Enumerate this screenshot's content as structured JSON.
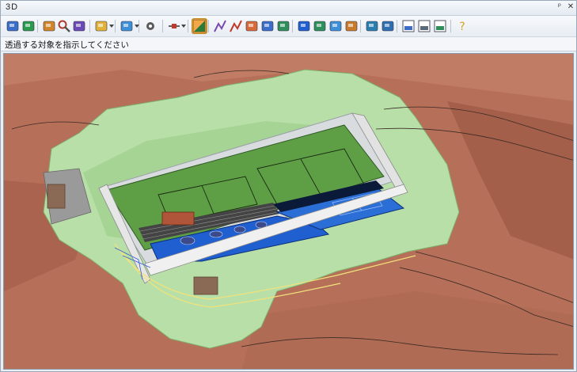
{
  "window": {
    "title": "3D",
    "pin_icon": "pin-icon",
    "close_icon": "close-icon"
  },
  "toolbar": {
    "tools": [
      {
        "name": "rotate-view-icon",
        "glyph": "rotate"
      },
      {
        "name": "globe-view-icon",
        "glyph": "globe"
      },
      {
        "name": "fit-view-icon",
        "glyph": "fit"
      },
      {
        "name": "zoom-icon",
        "glyph": "zoom"
      },
      {
        "name": "camera-view-icon",
        "glyph": "camera"
      },
      {
        "name": "light-icon",
        "glyph": "light"
      },
      {
        "name": "cube-view-icon",
        "glyph": "cube"
      },
      {
        "name": "settings-icon",
        "glyph": "settings"
      },
      {
        "name": "measure-icon",
        "glyph": "measure"
      },
      {
        "name": "surface-color-icon",
        "glyph": "surface"
      },
      {
        "name": "draw-line-icon",
        "glyph": "line"
      },
      {
        "name": "polyline-icon",
        "glyph": "polyline"
      },
      {
        "name": "terrain-icon",
        "glyph": "terrain"
      },
      {
        "name": "section-icon",
        "glyph": "section"
      },
      {
        "name": "slope-icon",
        "glyph": "slope"
      },
      {
        "name": "layer-icon",
        "glyph": "layer"
      },
      {
        "name": "tree-icon",
        "glyph": "tree"
      },
      {
        "name": "paint-icon",
        "glyph": "paint"
      },
      {
        "name": "book-icon",
        "glyph": "book"
      },
      {
        "name": "walk-icon",
        "glyph": "walk"
      },
      {
        "name": "person-icon",
        "glyph": "person"
      },
      {
        "name": "export-image-icon",
        "glyph": "export"
      },
      {
        "name": "print-icon",
        "glyph": "print"
      },
      {
        "name": "picture-icon",
        "glyph": "picture"
      },
      {
        "name": "help-icon",
        "glyph": "help"
      }
    ]
  },
  "prompt": {
    "text": "透過する対象を指示してください"
  },
  "colors": {
    "terrain": "#b8715a",
    "grass": "#a9d89a",
    "court": "#4f9a3c",
    "pool": "#1f5fd0",
    "accent": "#2b6fd6"
  }
}
